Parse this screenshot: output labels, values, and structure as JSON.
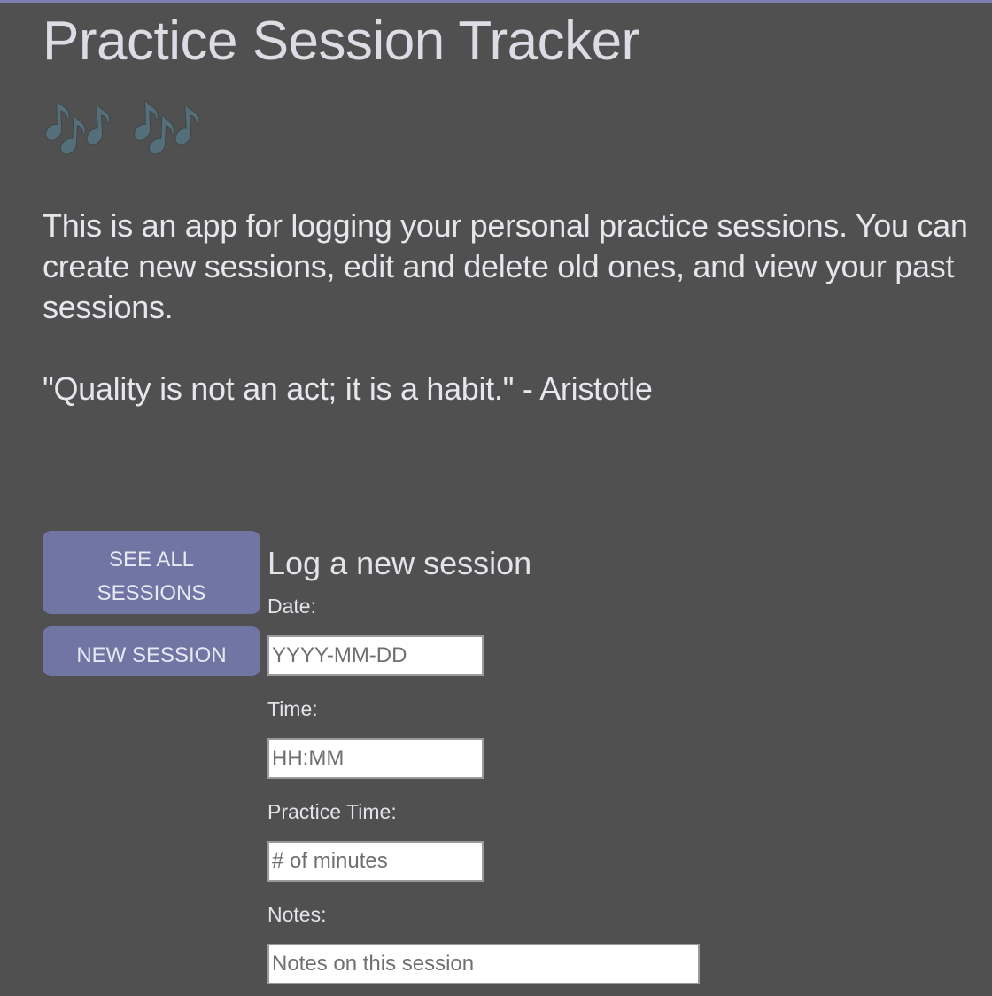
{
  "header": {
    "title": "Practice Session Tracker",
    "emoji": "🎶 🎶"
  },
  "intro": {
    "description": "This is an app for logging your personal practice sessions. You can create new sessions, edit and delete old ones, and view your past sessions.",
    "quote": "\"Quality is not an act; it is a habit.\" - Aristotle"
  },
  "nav": {
    "see_all_label": "SEE ALL SESSIONS",
    "new_session_label": "NEW SESSION"
  },
  "form": {
    "heading": "Log a new session",
    "date": {
      "label": "Date:",
      "placeholder": "YYYY-MM-DD",
      "value": ""
    },
    "time": {
      "label": "Time:",
      "placeholder": "HH:MM",
      "value": ""
    },
    "practice_time": {
      "label": "Practice Time:",
      "placeholder": "# of minutes",
      "value": ""
    },
    "notes": {
      "label": "Notes:",
      "placeholder": "Notes on this session",
      "value": ""
    }
  },
  "colors": {
    "background": "#505050",
    "accent": "#7075a3",
    "text": "#e3e3ea"
  }
}
